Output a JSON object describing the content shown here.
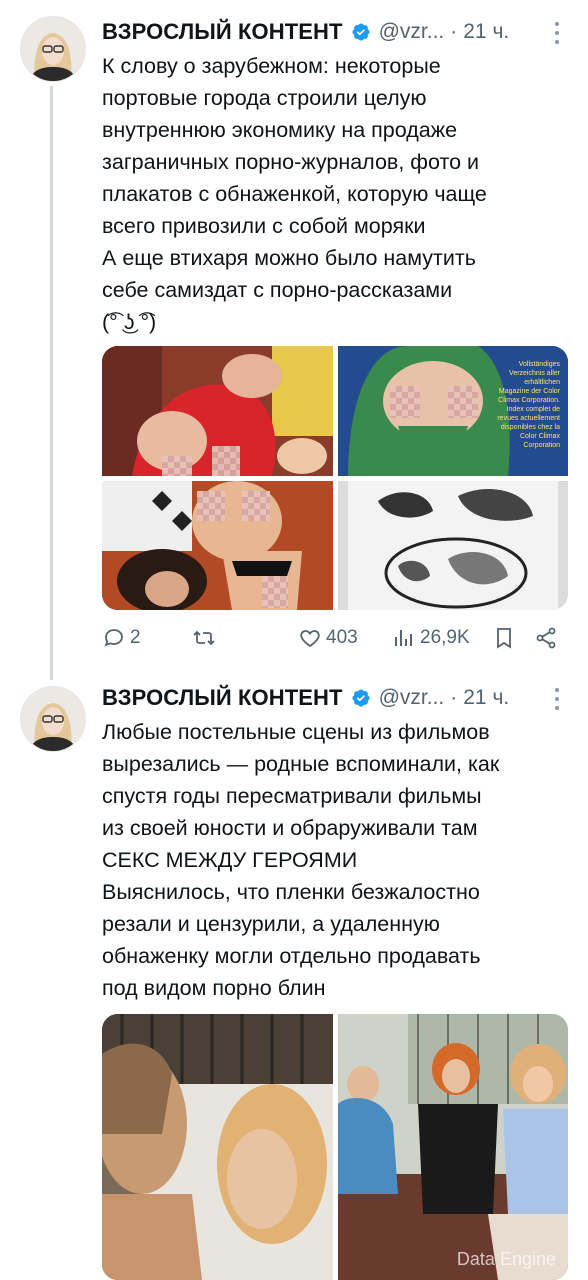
{
  "tweets": [
    {
      "author": "ВЗРОСЛЫЙ КОНТЕНТ",
      "handle": "@vzr...",
      "separator": "·",
      "time": "21 ч.",
      "text_lines": [
        "К слову о зарубежном: некоторые",
        "портовые города строили целую",
        "внутреннюю экономику на продаже",
        "заграничных порно-журналов, фото и",
        "плакатов с обнаженкой, которую чаще",
        "всего привозили с собой моряки",
        "А еще втихаря можно было намутить",
        "себе самиздат с порно-рассказами",
        "(͡° ͜ʖ ͡°)"
      ],
      "magazine_cover_text": "Vollständiges Verzeichnis aller erhältlichen Magazine der Color Climax Corporation. Index complet de revues actuellement disponibles chez la Color Climax Corporation",
      "actions": {
        "replies": "2",
        "retweets": "",
        "likes": "403",
        "views": "26,9K"
      }
    },
    {
      "author": "ВЗРОСЛЫЙ КОНТЕНТ",
      "handle": "@vzr...",
      "separator": "·",
      "time": "21 ч.",
      "text_lines": [
        "Любые постельные сцены из фильмов",
        "вырезались — родные вспоминали, как",
        "спустя годы пересматривали фильмы",
        "из своей юности и обраруживали там",
        "СЕКС МЕЖДУ ГЕРОЯМИ",
        "Выяснилось, что пленки безжалостно",
        "резали и цензурили, а удаленную",
        "обнаженку могли отдельно продавать",
        "под видом порно блин"
      ],
      "watermark": "Data Engine"
    }
  ],
  "colors": {
    "verified": "#1d9bf0",
    "muted": "#536471",
    "thread_line": "#cfd9de"
  },
  "icons": [
    "verified-badge-icon",
    "more-icon",
    "reply-icon",
    "retweet-icon",
    "like-icon",
    "views-icon",
    "bookmark-icon",
    "share-icon"
  ]
}
